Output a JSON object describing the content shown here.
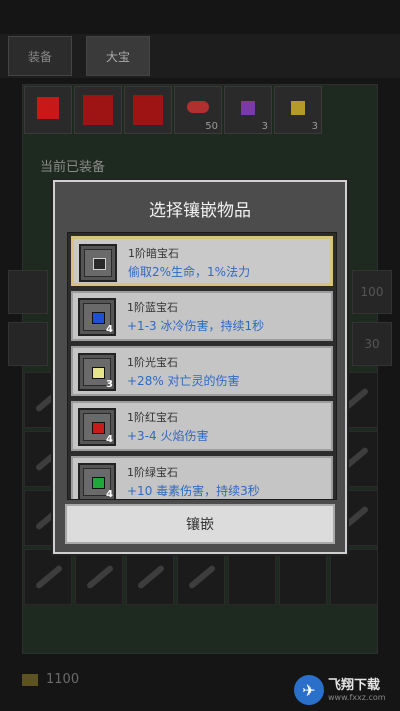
{
  "background": {
    "tabs": [
      {
        "label": "装备"
      },
      {
        "label": "大宝"
      }
    ],
    "gem_slots": [
      {
        "icon": "red-gem-icon",
        "color": "#c81818",
        "count": ""
      },
      {
        "icon": "red-armor-icon",
        "color": "#9e1414",
        "count": ""
      },
      {
        "icon": "red-armor-icon",
        "color": "#9e1414",
        "count": ""
      },
      {
        "icon": "red-leaf-icon",
        "color": "#b03030",
        "count": "50"
      },
      {
        "icon": "purple-gem-icon",
        "color": "#7a3aa8",
        "count": "3"
      },
      {
        "icon": "yellow-gem-icon",
        "color": "#b59a2a",
        "count": "3"
      }
    ],
    "equipped_label": "当前已装备",
    "side_left": [
      "整",
      "全"
    ],
    "side_right": [
      "100",
      "30"
    ],
    "coins": "1100"
  },
  "dialog": {
    "title": "选择镶嵌物品",
    "items": [
      {
        "name": "1阶暗宝石",
        "desc": "偷取2%生命，1%法力",
        "count": "",
        "gem_color": "#2a2a2a",
        "selected": true
      },
      {
        "name": "1阶蓝宝石",
        "desc": "+1-3 冰冷伤害，持续1秒",
        "count": "4",
        "gem_color": "#1f4fd6",
        "selected": false
      },
      {
        "name": "1阶光宝石",
        "desc": "+28% 对亡灵的伤害",
        "count": "3",
        "gem_color": "#e8e48a",
        "selected": false
      },
      {
        "name": "1阶红宝石",
        "desc": "+3-4 火焰伤害",
        "count": "4",
        "gem_color": "#c81c1c",
        "selected": false
      },
      {
        "name": "1阶绿宝石",
        "desc": "+10 毒素伤害，持续3秒",
        "count": "4",
        "gem_color": "#1fa83a",
        "selected": false
      }
    ],
    "inlay_button": "镶嵌"
  },
  "watermark": {
    "text": "飞翔下载",
    "sub": "www.fxxz.com"
  }
}
